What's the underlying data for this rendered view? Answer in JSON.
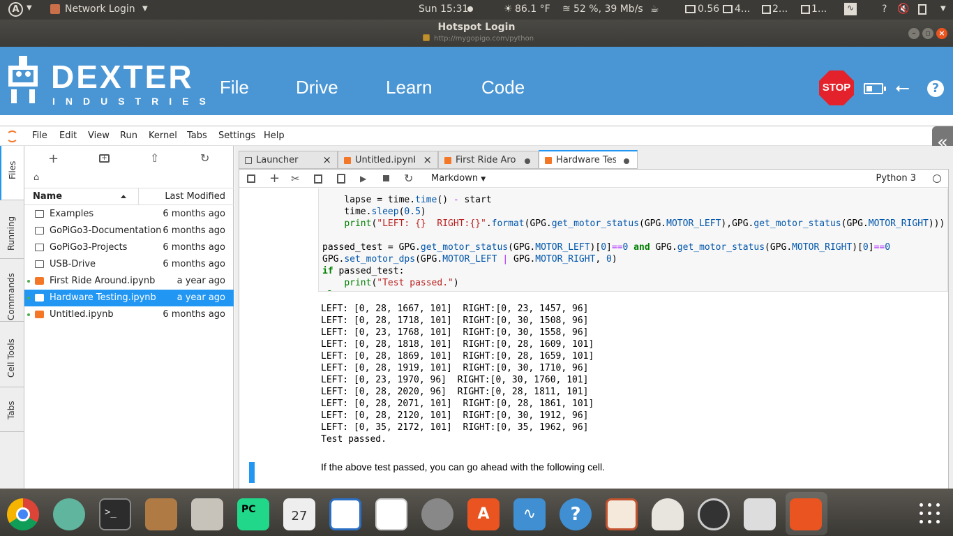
{
  "system_bar": {
    "app_menu": "Network Login",
    "clock": "Sun 15:31",
    "weather": "86.1 °F",
    "wifi": "52 %, 39 Mb/s",
    "load": "0.56",
    "cpu": "4...",
    "mem1": "2...",
    "mem2": "1...",
    "help": "?"
  },
  "window": {
    "title": "Hotspot Login",
    "url": "http://mygopigo.com/python"
  },
  "dexter": {
    "logo_text": "DEXTER",
    "logo_sub": "INDUSTRIES",
    "nav": [
      "File",
      "Drive",
      "Learn",
      "Code"
    ],
    "stop_label": "STOP",
    "help_label": "?"
  },
  "jupyter": {
    "menu": [
      "File",
      "Edit",
      "View",
      "Run",
      "Kernel",
      "Tabs",
      "Settings",
      "Help"
    ],
    "sidebar_tabs": [
      "Files",
      "Running",
      "Commands",
      "Cell Tools",
      "Tabs"
    ],
    "file_browser": {
      "col_name": "Name",
      "col_modified": "Last Modified",
      "rows": [
        {
          "name": "Examples",
          "modified": "6 months ago",
          "type": "folder"
        },
        {
          "name": "GoPiGo3-Documentation",
          "modified": "6 months ago",
          "type": "folder"
        },
        {
          "name": "GoPiGo3-Projects",
          "modified": "6 months ago",
          "type": "folder"
        },
        {
          "name": "USB-Drive",
          "modified": "6 months ago",
          "type": "folder"
        },
        {
          "name": "First Ride Around.ipynb",
          "modified": "a year ago",
          "type": "notebook"
        },
        {
          "name": "Hardware Testing.ipynb",
          "modified": "a year ago",
          "type": "notebook"
        },
        {
          "name": "Untitled.ipynb",
          "modified": "6 months ago",
          "type": "notebook"
        }
      ]
    },
    "tabs": [
      "Launcher",
      "Untitled.ipynb",
      "First Ride Arou",
      "Hardware Testi"
    ],
    "toolbar": {
      "cell_type": "Markdown",
      "kernel": "Python 3"
    },
    "output_lines": [
      "LEFT: [0, 28, 1667, 101]  RIGHT:[0, 23, 1457, 96]",
      "LEFT: [0, 28, 1718, 101]  RIGHT:[0, 30, 1508, 96]",
      "LEFT: [0, 23, 1768, 101]  RIGHT:[0, 30, 1558, 96]",
      "LEFT: [0, 28, 1818, 101]  RIGHT:[0, 28, 1609, 101]",
      "LEFT: [0, 28, 1869, 101]  RIGHT:[0, 28, 1659, 101]",
      "LEFT: [0, 28, 1919, 101]  RIGHT:[0, 30, 1710, 96]",
      "LEFT: [0, 23, 1970, 96]  RIGHT:[0, 30, 1760, 101]",
      "LEFT: [0, 28, 2020, 96]  RIGHT:[0, 28, 1811, 101]",
      "LEFT: [0, 28, 2071, 101]  RIGHT:[0, 28, 1861, 101]",
      "LEFT: [0, 28, 2120, 101]  RIGHT:[0, 30, 1912, 96]",
      "LEFT: [0, 35, 2172, 101]  RIGHT:[0, 35, 1962, 96]",
      "Test passed."
    ],
    "markdown_text": "If the above test passed, you can go ahead with the following cell."
  },
  "colors": {
    "dexter_blue": "#4a96d4",
    "jupyter_orange": "#f37726",
    "selection_blue": "#2196f3",
    "stop_red": "#e4222b"
  },
  "dock": {
    "icons": [
      "chrome-icon",
      "atom-icon",
      "terminal-icon",
      "minecraft-icon",
      "files-icon",
      "pycharm-icon",
      "calendar-icon",
      "writer-icon",
      "pdf-icon",
      "settings-icon",
      "store-icon",
      "monitor-icon",
      "help-icon",
      "impress-icon",
      "java-icon",
      "updater-icon",
      "mixer-icon",
      "folder-icon",
      "apps-grid-icon"
    ],
    "calendar_day": "27"
  }
}
